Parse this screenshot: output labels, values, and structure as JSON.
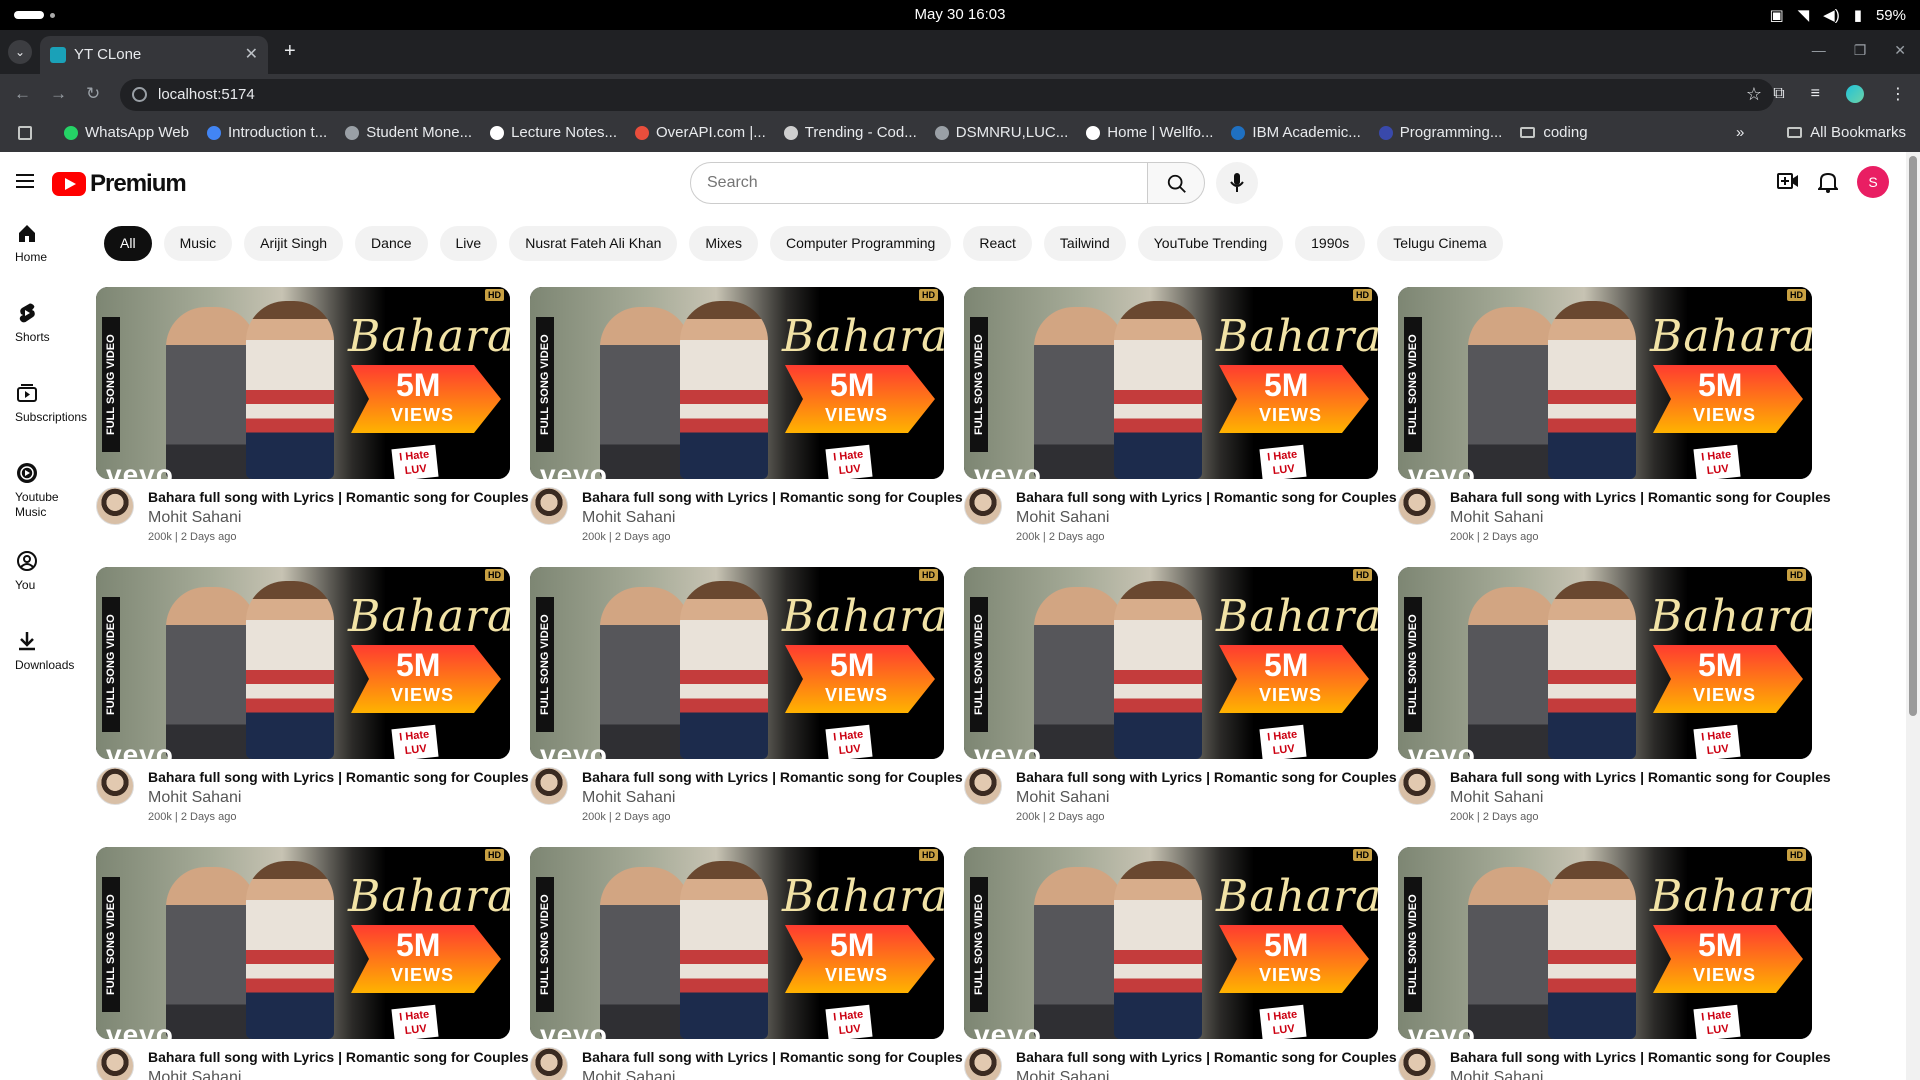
{
  "os": {
    "clock": "May 30  16:03",
    "battery": "59%"
  },
  "browser": {
    "tab_title": "YT CLone",
    "url": "localhost:5174",
    "bookmarks": [
      {
        "label": "WhatsApp Web",
        "color": "#25d366"
      },
      {
        "label": "Introduction t...",
        "color": "#4285f4"
      },
      {
        "label": "Student Mone...",
        "color": "#9aa0a6"
      },
      {
        "label": "Lecture Notes...",
        "color": "#ffffff"
      },
      {
        "label": "OverAPI.com |...",
        "color": "#e94e3c"
      },
      {
        "label": "Trending - Cod...",
        "color": "#cfcfcf"
      },
      {
        "label": "DSMNRU,LUC...",
        "color": "#9aa0a6"
      },
      {
        "label": "Home | Wellfo...",
        "color": "#ffffff"
      },
      {
        "label": "IBM Academic...",
        "color": "#1f70c1"
      },
      {
        "label": "Programming...",
        "color": "#3949ab"
      },
      {
        "label": "coding",
        "color": "folder"
      }
    ],
    "bookmarks_more": "»",
    "all_bookmarks": "All Bookmarks"
  },
  "yt": {
    "logo_text": "Premium",
    "search_placeholder": "Search",
    "avatar_letter": "S",
    "sidebar": [
      {
        "label": "Home",
        "icon": "home-icon"
      },
      {
        "label": "Shorts",
        "icon": "shorts-icon"
      },
      {
        "label": "Subscriptions",
        "icon": "subscriptions-icon"
      },
      {
        "label": "Youtube Music",
        "icon": "music-icon"
      },
      {
        "label": "You",
        "icon": "you-icon"
      },
      {
        "label": "Downloads",
        "icon": "download-icon"
      }
    ],
    "chips": [
      "All",
      "Music",
      "Arijit Singh",
      "Dance",
      "Live",
      "Nusrat Fateh Ali Khan",
      "Mixes",
      "Computer Programming",
      "React",
      "Tailwind",
      "YouTube Trending",
      "1990s",
      "Telugu Cinema"
    ],
    "video": {
      "title": "Bahara full song with Lyrics | Romantic song for Couples",
      "channel": "Mohit Sahani",
      "stats": "200k | 2 Days ago",
      "thumb_title": "Bahara",
      "thumb_views_number": "5M",
      "thumb_views_word": "VIEWS",
      "thumb_side": "FULL SONG VIDEO",
      "thumb_vevo": "vevo",
      "thumb_hd": "HD",
      "thumb_sticker": "I Hate LUV Storys"
    },
    "video_count": 12
  }
}
